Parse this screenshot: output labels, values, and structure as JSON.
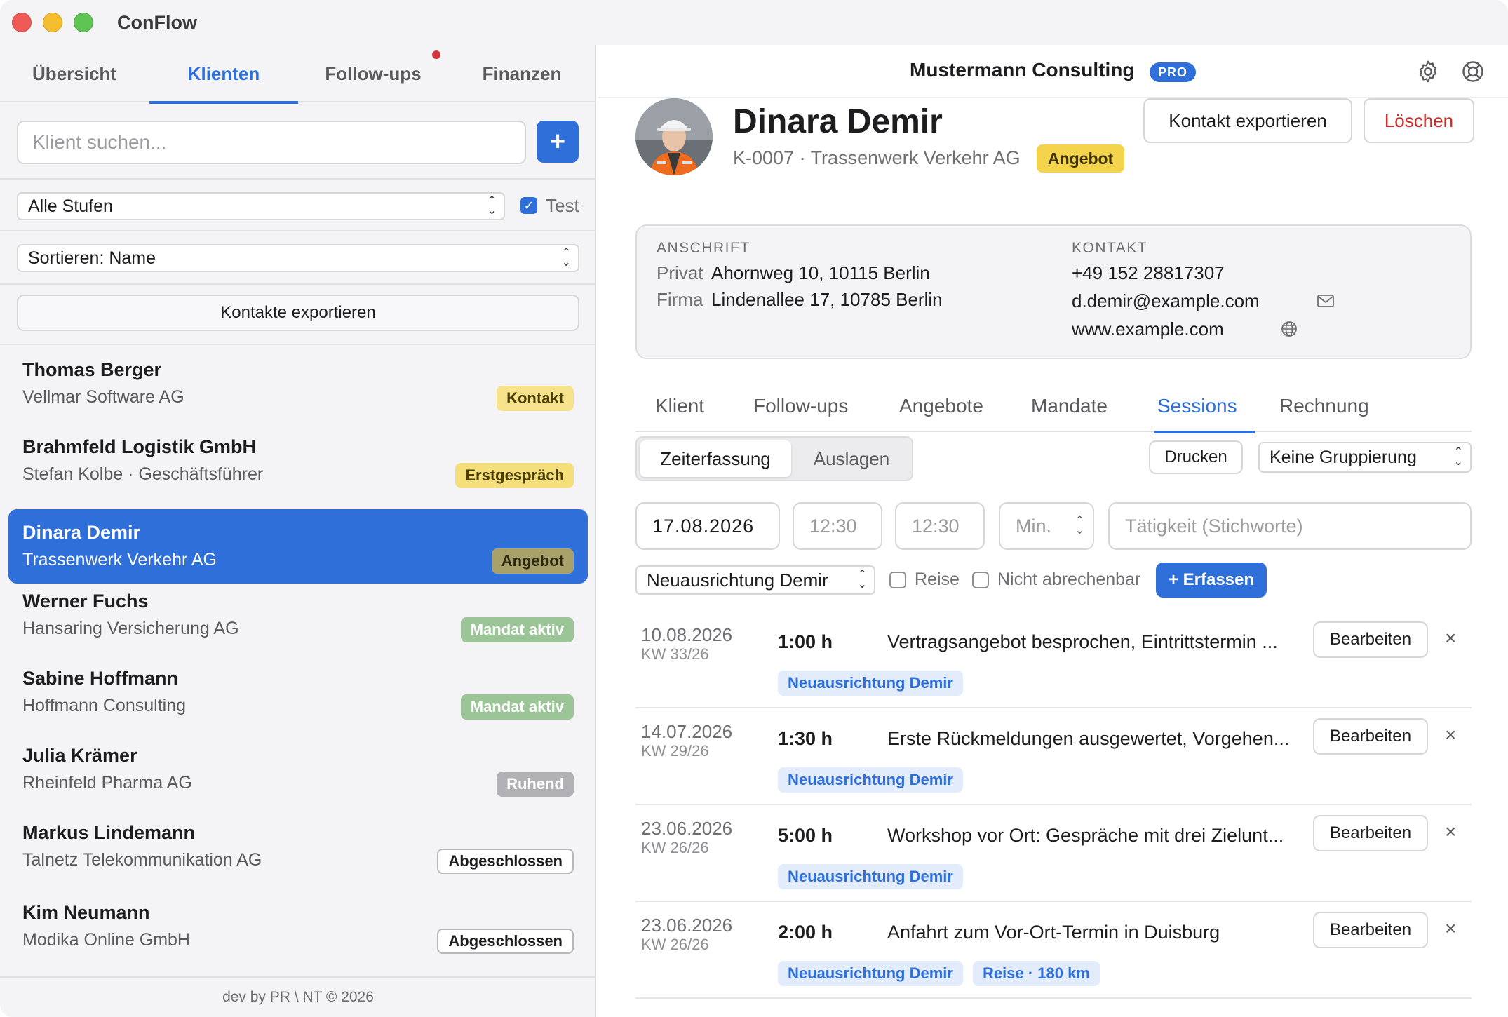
{
  "app": {
    "title": "ConFlow"
  },
  "sidebar": {
    "tabs": [
      {
        "label": "Übersicht"
      },
      {
        "label": "Klienten"
      },
      {
        "label": "Follow-ups"
      },
      {
        "label": "Finanzen"
      }
    ],
    "search": {
      "placeholder": "Klient suchen...",
      "value": ""
    },
    "add_label": "+",
    "stage_filter": "Alle Stufen",
    "test_checkbox": {
      "label": "Test",
      "checked": true
    },
    "sort": "Sortieren: Name",
    "export_label": "Kontakte exportieren",
    "clients": [
      {
        "name": "Thomas Berger",
        "sub": "Vellmar Software AG",
        "badge": "Kontakt"
      },
      {
        "name": "Brahmfeld Logistik GmbH",
        "sub": "Stefan Kolbe · Geschäftsführer",
        "badge": "Erstgespräch"
      },
      {
        "name": "Dinara Demir",
        "sub": "Trassenwerk Verkehr AG",
        "badge": "Angebot"
      },
      {
        "name": "Werner Fuchs",
        "sub": "Hansaring Versicherung AG",
        "badge": "Mandat aktiv"
      },
      {
        "name": "Sabine Hoffmann",
        "sub": "Hoffmann Consulting",
        "badge": "Mandat aktiv"
      },
      {
        "name": "Julia Krämer",
        "sub": "Rheinfeld Pharma AG",
        "badge": "Ruhend"
      },
      {
        "name": "Markus Lindemann",
        "sub": "Talnetz Telekommunikation AG",
        "badge": "Abgeschlossen"
      },
      {
        "name": "Kim Neumann",
        "sub": "Modika Online GmbH",
        "badge": "Abgeschlossen"
      }
    ],
    "footer": "dev by PR \\ NT © 2026"
  },
  "header": {
    "company": "Mustermann Consulting",
    "plan": "PRO"
  },
  "client": {
    "name": "Dinara Demir",
    "meta": "K-0007 · Trassenwerk Verkehr AG",
    "stage": "Angebot",
    "export_label": "Kontakt exportieren",
    "delete_label": "Löschen",
    "address": {
      "title": "ANSCHRIFT",
      "private_label": "Privat",
      "private": "Ahornweg 10, 10115 Berlin",
      "company_label": "Firma",
      "company": "Lindenallee 17, 10785 Berlin"
    },
    "contact": {
      "title": "KONTAKT",
      "phone": "+49 152 28817307",
      "email": "d.demir@example.com",
      "web": "www.example.com"
    }
  },
  "detail_tabs": [
    {
      "label": "Klient"
    },
    {
      "label": "Follow-ups"
    },
    {
      "label": "Angebote"
    },
    {
      "label": "Mandate"
    },
    {
      "label": "Sessions"
    },
    {
      "label": "Rechnung"
    }
  ],
  "sessions": {
    "segments": [
      {
        "label": "Zeiterfassung"
      },
      {
        "label": "Auslagen"
      }
    ],
    "print_label": "Drucken",
    "grouping": "Keine Gruppierung",
    "form": {
      "date": "17.08.2026",
      "start": "12:30",
      "end": "12:30",
      "minutes_placeholder": "Min.",
      "activity_placeholder": "Tätigkeit (Stichworte)",
      "mandate": "Neuausrichtung Demir",
      "travel_label": "Reise",
      "non_billable_label": "Nicht abrechenbar",
      "submit_label": "+ Erfassen"
    },
    "edit_label": "Bearbeiten",
    "delete_glyph": "×",
    "entries": [
      {
        "date": "10.08.2026",
        "kw": "KW 33/26",
        "duration": "1:00 h",
        "desc": "Vertragsangebot besprochen, Eintrittstermin ...",
        "tags": [
          "Neuausrichtung Demir"
        ]
      },
      {
        "date": "14.07.2026",
        "kw": "KW 29/26",
        "duration": "1:30 h",
        "desc": "Erste Rückmeldungen ausgewertet, Vorgehen...",
        "tags": [
          "Neuausrichtung Demir"
        ]
      },
      {
        "date": "23.06.2026",
        "kw": "KW 26/26",
        "duration": "5:00 h",
        "desc": "Workshop vor Ort: Gespräche mit drei Zielunt...",
        "tags": [
          "Neuausrichtung Demir"
        ]
      },
      {
        "date": "23.06.2026",
        "kw": "KW 26/26",
        "duration": "2:00 h",
        "desc": "Anfahrt zum Vor-Ort-Termin in Duisburg",
        "tags": [
          "Neuausrichtung Demir",
          "Reise · 180 km"
        ]
      }
    ]
  },
  "colors": {
    "accent": "#2f6fd9",
    "danger": "#d12a2a"
  }
}
